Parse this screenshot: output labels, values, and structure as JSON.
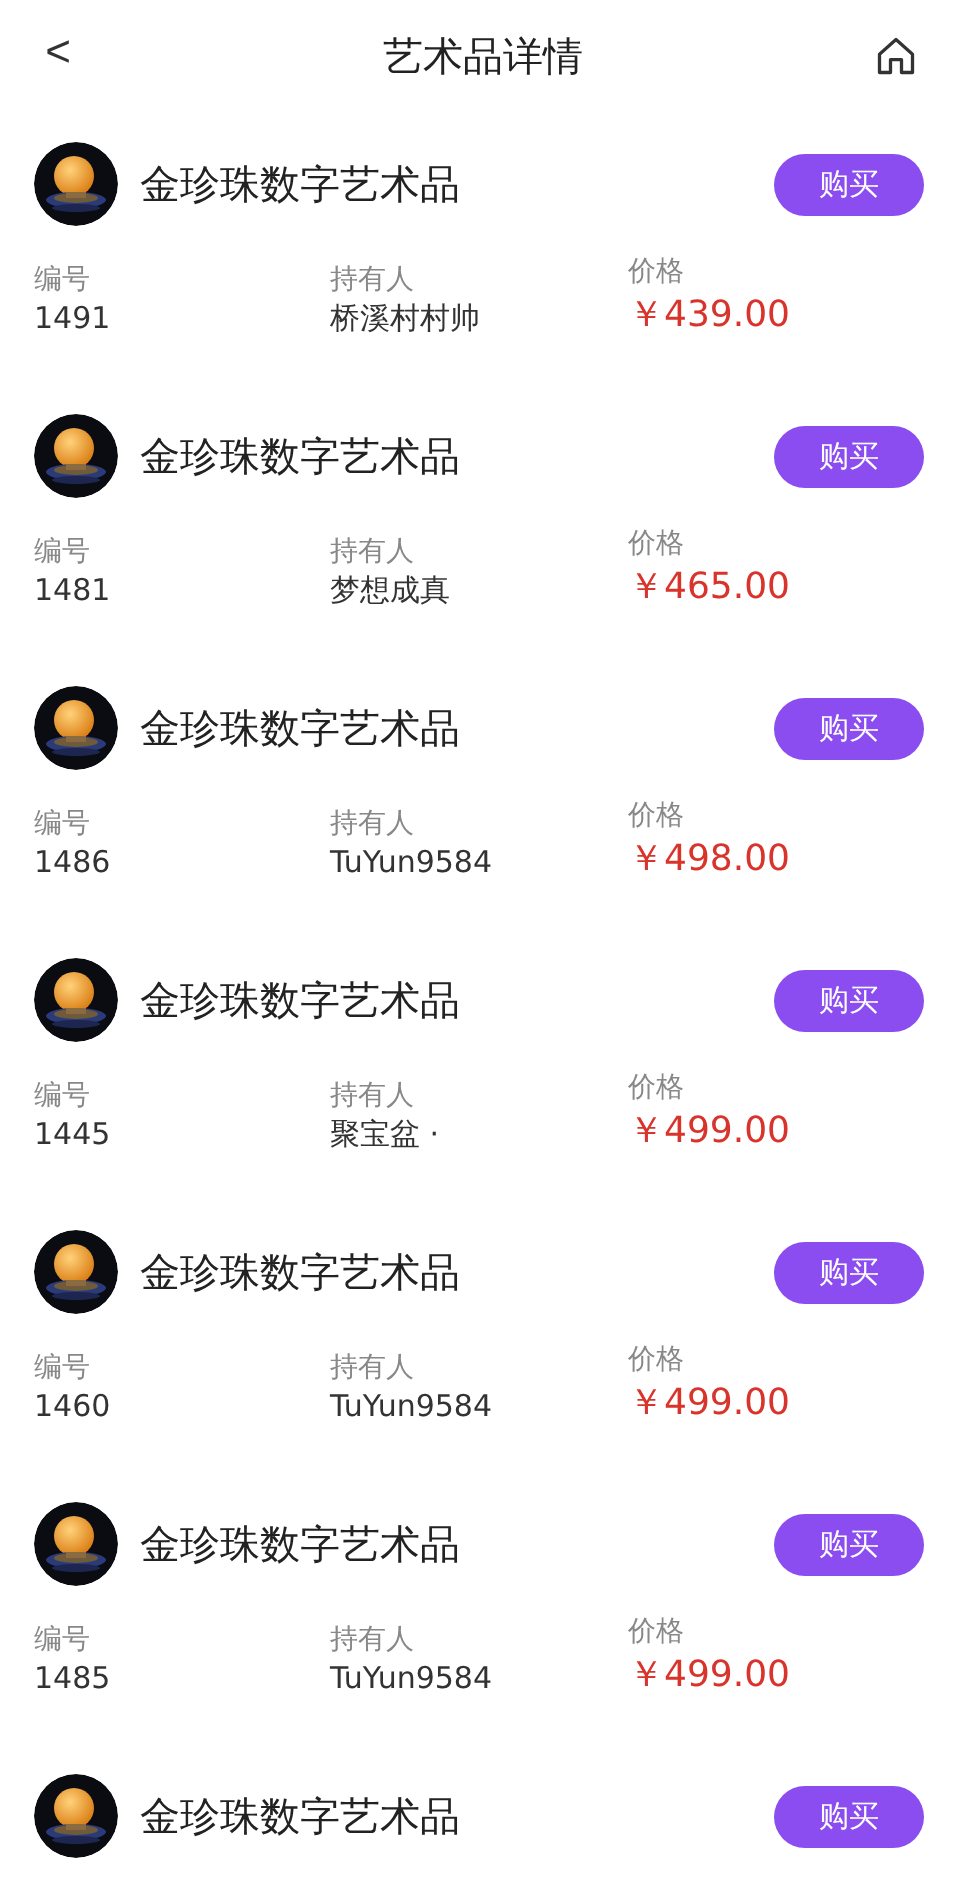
{
  "header": {
    "back": "<",
    "title": "艺术品详情"
  },
  "items": [
    {
      "name": "金珍珠数字艺术品",
      "button": "购买",
      "number_label": "编号",
      "number": "1491",
      "owner_label": "持有人",
      "owner": "桥溪村村帅",
      "price_label": "价格",
      "price": "￥439.00"
    },
    {
      "name": "金珍珠数字艺术品",
      "button": "购买",
      "number_label": "编号",
      "number": "1481",
      "owner_label": "持有人",
      "owner": "梦想成真",
      "price_label": "价格",
      "price": "￥465.00"
    },
    {
      "name": "金珍珠数字艺术品",
      "button": "购买",
      "number_label": "编号",
      "number": "1486",
      "owner_label": "持有人",
      "owner": "TuYun9584",
      "price_label": "价格",
      "price": "￥498.00"
    },
    {
      "name": "金珍珠数字艺术品",
      "button": "购买",
      "number_label": "编号",
      "number": "1445",
      "owner_label": "持有人",
      "owner": "聚宝盆 ·",
      "price_label": "价格",
      "price": "￥499.00"
    },
    {
      "name": "金珍珠数字艺术品",
      "button": "购买",
      "number_label": "编号",
      "number": "1460",
      "owner_label": "持有人",
      "owner": "TuYun9584",
      "price_label": "价格",
      "price": "￥499.00"
    },
    {
      "name": "金珍珠数字艺术品",
      "button": "购买",
      "number_label": "编号",
      "number": "1485",
      "owner_label": "持有人",
      "owner": "TuYun9584",
      "price_label": "价格",
      "price": "￥499.00"
    },
    {
      "name": "金珍珠数字艺术品",
      "button": "购买"
    }
  ]
}
